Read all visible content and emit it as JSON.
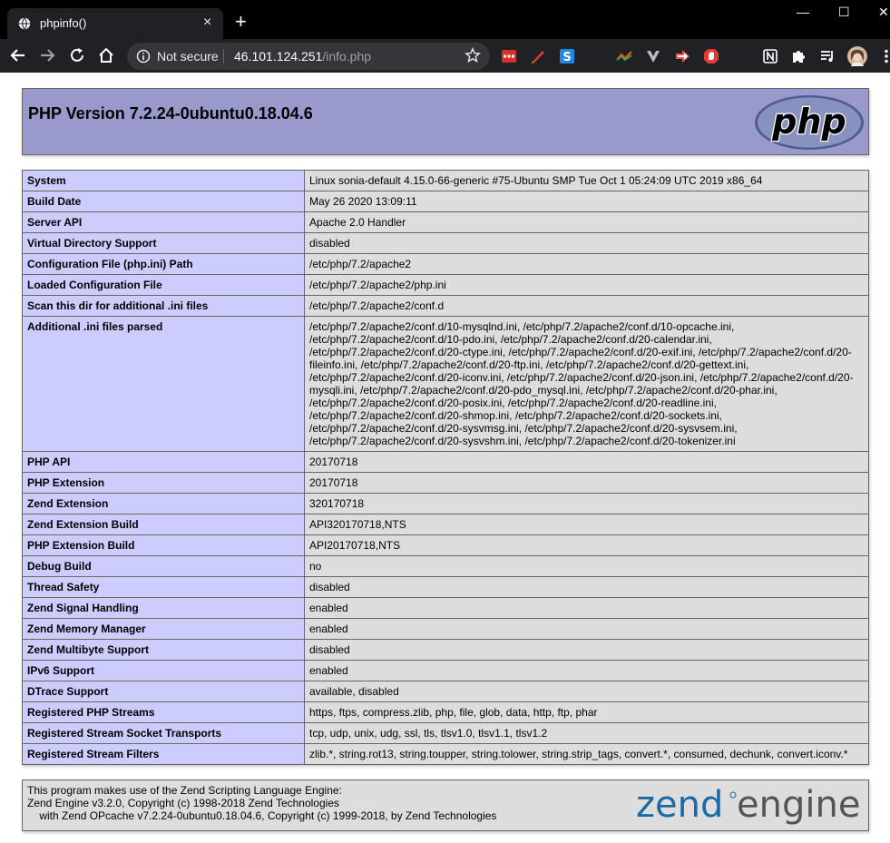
{
  "browser": {
    "tab_title": "phpinfo()",
    "tab_close": "×",
    "new_tab": "+",
    "security_label": "Not secure",
    "url_host": "46.101.124.251",
    "url_path": "/info.php",
    "window_minimize": "—",
    "window_maximize": "☐",
    "window_close": "✕"
  },
  "header": {
    "title": "PHP Version 7.2.24-0ubuntu0.18.04.6",
    "logo_text": "php"
  },
  "rows": [
    {
      "key": "System",
      "value": "Linux sonia-default 4.15.0-66-generic #75-Ubuntu SMP Tue Oct 1 05:24:09 UTC 2019 x86_64"
    },
    {
      "key": "Build Date",
      "value": "May 26 2020 13:09:11"
    },
    {
      "key": "Server API",
      "value": "Apache 2.0 Handler"
    },
    {
      "key": "Virtual Directory Support",
      "value": "disabled"
    },
    {
      "key": "Configuration File (php.ini) Path",
      "value": "/etc/php/7.2/apache2"
    },
    {
      "key": "Loaded Configuration File",
      "value": "/etc/php/7.2/apache2/php.ini"
    },
    {
      "key": "Scan this dir for additional .ini files",
      "value": "/etc/php/7.2/apache2/conf.d"
    },
    {
      "key": "Additional .ini files parsed",
      "value": "/etc/php/7.2/apache2/conf.d/10-mysqlnd.ini, /etc/php/7.2/apache2/conf.d/10-opcache.ini, /etc/php/7.2/apache2/conf.d/10-pdo.ini, /etc/php/7.2/apache2/conf.d/20-calendar.ini, /etc/php/7.2/apache2/conf.d/20-ctype.ini, /etc/php/7.2/apache2/conf.d/20-exif.ini, /etc/php/7.2/apache2/conf.d/20-fileinfo.ini, /etc/php/7.2/apache2/conf.d/20-ftp.ini, /etc/php/7.2/apache2/conf.d/20-gettext.ini, /etc/php/7.2/apache2/conf.d/20-iconv.ini, /etc/php/7.2/apache2/conf.d/20-json.ini, /etc/php/7.2/apache2/conf.d/20-mysqli.ini, /etc/php/7.2/apache2/conf.d/20-pdo_mysql.ini, /etc/php/7.2/apache2/conf.d/20-phar.ini, /etc/php/7.2/apache2/conf.d/20-posix.ini, /etc/php/7.2/apache2/conf.d/20-readline.ini, /etc/php/7.2/apache2/conf.d/20-shmop.ini, /etc/php/7.2/apache2/conf.d/20-sockets.ini, /etc/php/7.2/apache2/conf.d/20-sysvmsg.ini, /etc/php/7.2/apache2/conf.d/20-sysvsem.ini, /etc/php/7.2/apache2/conf.d/20-sysvshm.ini, /etc/php/7.2/apache2/conf.d/20-tokenizer.ini"
    },
    {
      "key": "PHP API",
      "value": "20170718"
    },
    {
      "key": "PHP Extension",
      "value": "20170718"
    },
    {
      "key": "Zend Extension",
      "value": "320170718"
    },
    {
      "key": "Zend Extension Build",
      "value": "API320170718,NTS"
    },
    {
      "key": "PHP Extension Build",
      "value": "API20170718,NTS"
    },
    {
      "key": "Debug Build",
      "value": "no"
    },
    {
      "key": "Thread Safety",
      "value": "disabled"
    },
    {
      "key": "Zend Signal Handling",
      "value": "enabled"
    },
    {
      "key": "Zend Memory Manager",
      "value": "enabled"
    },
    {
      "key": "Zend Multibyte Support",
      "value": "disabled"
    },
    {
      "key": "IPv6 Support",
      "value": "enabled"
    },
    {
      "key": "DTrace Support",
      "value": "available, disabled"
    },
    {
      "key": "Registered PHP Streams",
      "value": "https, ftps, compress.zlib, php, file, glob, data, http, ftp, phar"
    },
    {
      "key": "Registered Stream Socket Transports",
      "value": "tcp, udp, unix, udg, ssl, tls, tlsv1.0, tlsv1.1, tlsv1.2"
    },
    {
      "key": "Registered Stream Filters",
      "value": "zlib.*, string.rot13, string.toupper, string.tolower, string.strip_tags, convert.*, consumed, dechunk, convert.iconv.*"
    }
  ],
  "footer": {
    "line1": "This program makes use of the Zend Scripting Language Engine:",
    "line2": "Zend Engine v3.2.0, Copyright (c) 1998-2018 Zend Technologies",
    "line3": "    with Zend OPcache v7.2.24-0ubuntu0.18.04.6, Copyright (c) 1999-2018, by Zend Technologies",
    "logo_text_1": "zend",
    "logo_text_2": "engine"
  },
  "colors": {
    "header_bg": "#9999cc",
    "key_bg": "#ccccff",
    "value_bg": "#dddddd",
    "zend_blue": "#1b6aa5"
  },
  "icons": {
    "tab_favicon": "globe-icon",
    "back": "arrow-left-icon",
    "forward": "arrow-right-icon",
    "reload": "reload-icon",
    "home": "home-icon",
    "info": "info-icon",
    "bookmark": "star-icon",
    "extensions": [
      "ext-red-icon",
      "ext-pen-icon",
      "ext-s-icon",
      "ext-chart-icon",
      "ext-v-icon",
      "ext-arrow-icon",
      "ext-hand-icon",
      "notion-icon",
      "puzzle-icon",
      "media-icon",
      "avatar",
      "menu-icon"
    ]
  }
}
